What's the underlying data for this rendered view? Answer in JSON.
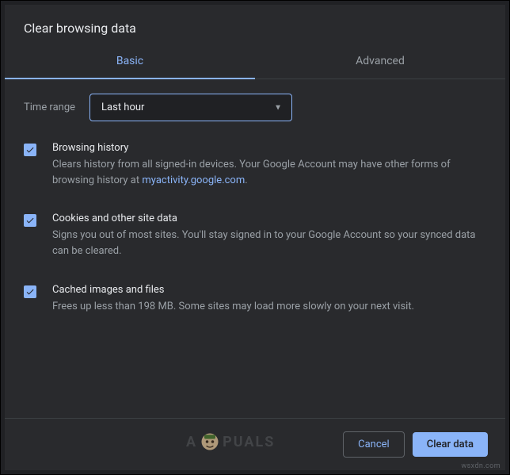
{
  "title": "Clear browsing data",
  "tabs": {
    "basic": "Basic",
    "advanced": "Advanced"
  },
  "timeRange": {
    "label": "Time range",
    "value": "Last hour"
  },
  "options": {
    "history": {
      "title": "Browsing history",
      "desc_before": "Clears history from all signed-in devices. Your Google Account may have other forms of browsing history at ",
      "link": "myactivity.google.com",
      "desc_after": "."
    },
    "cookies": {
      "title": "Cookies and other site data",
      "desc": "Signs you out of most sites. You'll stay signed in to your Google Account so your synced data can be cleared."
    },
    "cache": {
      "title": "Cached images and files",
      "desc": "Frees up less than 198 MB. Some sites may load more slowly on your next visit."
    }
  },
  "buttons": {
    "cancel": "Cancel",
    "clear": "Clear data"
  },
  "watermark": "wsxdn.com",
  "brand": {
    "before": "A",
    "after": "PUALS"
  }
}
